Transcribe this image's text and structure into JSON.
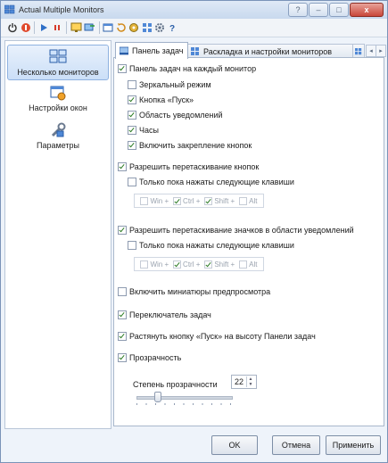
{
  "window": {
    "title": "Actual Multiple Monitors"
  },
  "window_buttons": {
    "help": "?",
    "minimize": "–",
    "maximize": "□",
    "close": "x"
  },
  "toolbar": {
    "icons": [
      "power-icon",
      "stop-icon",
      "play-icon",
      "pause-icon",
      "monitor-icon",
      "monitor-arrow-icon",
      "window-icon",
      "refresh-icon",
      "desktop-icon",
      "grid-icon",
      "gear-icon",
      "help-icon"
    ]
  },
  "sidebar": {
    "items": [
      {
        "label": "Несколько мониторов",
        "icon": "multi-monitor-icon",
        "selected": true
      },
      {
        "label": "Настройки окон",
        "icon": "window-settings-icon",
        "selected": false
      },
      {
        "label": "Параметры",
        "icon": "tools-icon",
        "selected": false
      }
    ]
  },
  "tabs": [
    {
      "label": "Панель задач",
      "active": true
    },
    {
      "label": "Раскладка и настройки мониторов",
      "active": false
    }
  ],
  "tab_nav": {
    "prev": "◂",
    "next": "▸"
  },
  "taskbar": {
    "per_monitor": {
      "label": "Панель задач на каждый монитор",
      "checked": true
    },
    "mirror": {
      "label": "Зеркальный режим",
      "checked": false
    },
    "start_button": {
      "label": "Кнопка «Пуск»",
      "checked": true
    },
    "notification_area": {
      "label": "Область уведомлений",
      "checked": true
    },
    "clock": {
      "label": "Часы",
      "checked": true
    },
    "pin_buttons": {
      "label": "Включить закрепление кнопок",
      "checked": true
    },
    "drag_buttons": {
      "label": "Разрешить перетаскивание кнопок",
      "checked": true
    },
    "drag_buttons_keys_only": {
      "label": "Только пока нажаты следующие клавиши",
      "checked": false
    },
    "keys1": {
      "win": "Win +",
      "ctrl": "Ctrl +",
      "shift": "Shift +",
      "alt": "Alt"
    },
    "drag_tray": {
      "label": "Разрешить перетаскивание значков в области уведомлений",
      "checked": true
    },
    "drag_tray_keys_only": {
      "label": "Только пока нажаты следующие клавиши",
      "checked": false
    },
    "keys2": {
      "win": "Win +",
      "ctrl": "Ctrl +",
      "shift": "Shift +",
      "alt": "Alt"
    },
    "thumbnails": {
      "label": "Включить миниатюры предпросмотра",
      "checked": false
    },
    "task_switcher": {
      "label": "Переключатель задач",
      "checked": true
    },
    "stretch_start": {
      "label": "Растянуть кнопку «Пуск» на высоту Панели задач",
      "checked": true
    },
    "transparency": {
      "label": "Прозрачность",
      "checked": true
    },
    "transparency_level": {
      "label": "Степень прозрачности",
      "value": "22",
      "slider_fraction": 0.22
    }
  },
  "buttons": {
    "ok": "OK",
    "cancel": "Отмена",
    "apply": "Применить"
  },
  "colors": {
    "accent": "#3d7ad1",
    "window_border": "#7a93b8",
    "check": "#2a7a22"
  }
}
